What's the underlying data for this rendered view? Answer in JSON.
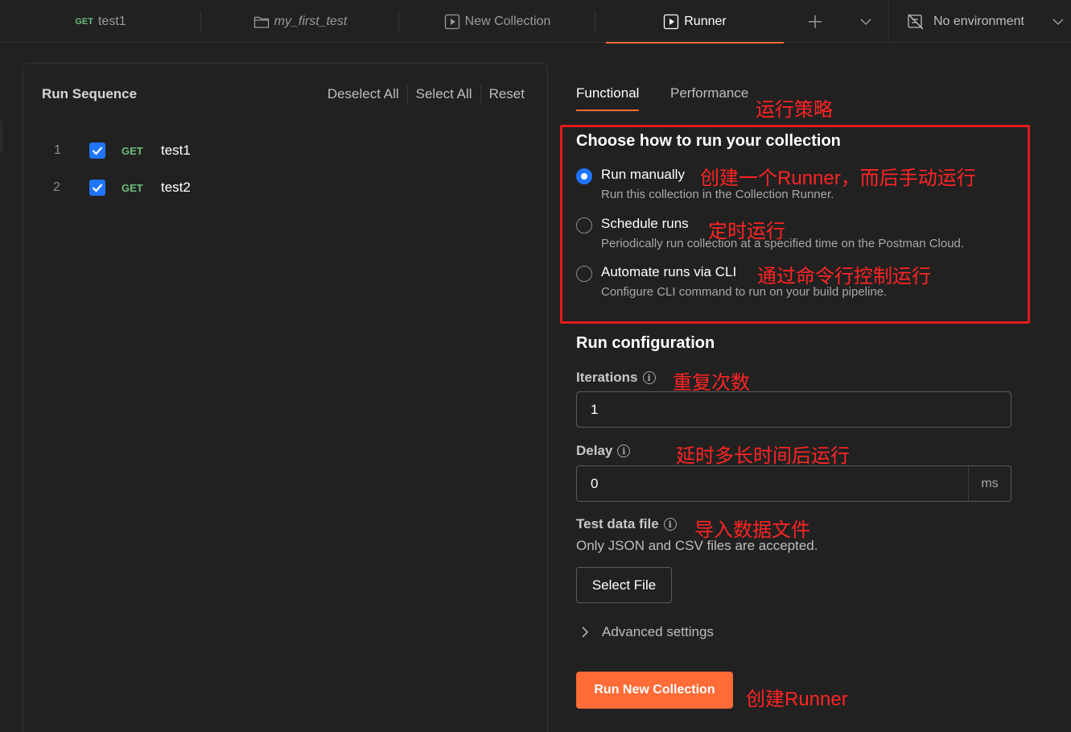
{
  "tabs": [
    {
      "method": "GET",
      "label": "test1"
    },
    {
      "label": "my_first_test",
      "icon": "folder-icon"
    },
    {
      "label": "New Collection",
      "icon": "play-icon"
    },
    {
      "label": "Runner",
      "icon": "play-icon",
      "active": true
    }
  ],
  "environment": {
    "label": "No environment",
    "icon": "no-environment-icon"
  },
  "run_sequence": {
    "title": "Run Sequence",
    "actions": {
      "deselect_all": "Deselect All",
      "select_all": "Select All",
      "reset": "Reset"
    },
    "items": [
      {
        "index": "1",
        "method": "GET",
        "name": "test1",
        "checked": true
      },
      {
        "index": "2",
        "method": "GET",
        "name": "test2",
        "checked": true
      }
    ]
  },
  "runner_tabs": {
    "functional": "Functional",
    "performance": "Performance"
  },
  "choose": {
    "title": "Choose how to run your collection",
    "options": [
      {
        "label": "Run manually",
        "desc": "Run this collection in the Collection Runner.",
        "selected": true
      },
      {
        "label": "Schedule runs",
        "desc": "Periodically run collection at a specified time on the Postman Cloud.",
        "selected": false
      },
      {
        "label": "Automate runs via CLI",
        "desc": "Configure CLI command to run on your build pipeline.",
        "selected": false
      }
    ]
  },
  "config": {
    "title": "Run configuration",
    "iterations_label": "Iterations",
    "iterations_value": "1",
    "delay_label": "Delay",
    "delay_value": "0",
    "delay_unit": "ms",
    "test_data_label": "Test data file",
    "test_data_hint": "Only JSON and CSV files are accepted.",
    "select_file": "Select File",
    "advanced": "Advanced settings",
    "run_button": "Run New Collection"
  },
  "annotations": {
    "strategy": "运行策略",
    "manual": "创建一个Runner，而后手动运行",
    "schedule": "定时运行",
    "cli": "通过命令行控制运行",
    "iterations": "重复次数",
    "delay": "延时多长时间后运行",
    "data_file": "导入数据文件",
    "create": "创建Runner"
  },
  "colors": {
    "accent": "#ff6c37",
    "checkbox": "#1f75ff",
    "method_get": "#6bbd7b",
    "annotation": "#ff2424"
  }
}
